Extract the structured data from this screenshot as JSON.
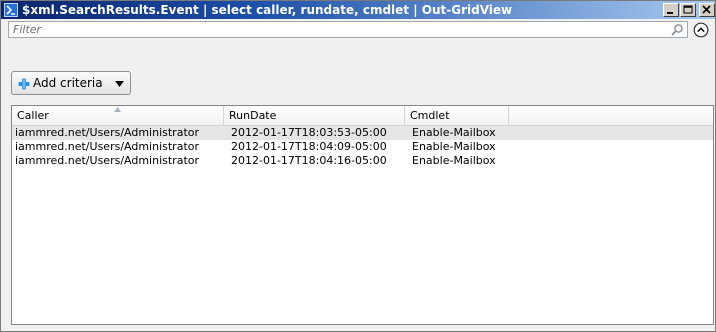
{
  "window": {
    "title": "$xml.SearchResults.Event | select caller, rundate, cmdlet | Out-GridView"
  },
  "filter": {
    "placeholder": "Filter",
    "value": ""
  },
  "toolbar": {
    "add_criteria_label": "Add criteria"
  },
  "grid": {
    "columns": [
      "Caller",
      "RunDate",
      "Cmdlet"
    ],
    "rows": [
      {
        "caller": "iammred.net/Users/Administrator",
        "rundate": "2012-01-17T18:03:53-05:00",
        "cmdlet": "Enable-Mailbox"
      },
      {
        "caller": "iammred.net/Users/Administrator",
        "rundate": "2012-01-17T18:04:09-05:00",
        "cmdlet": "Enable-Mailbox"
      },
      {
        "caller": "iammred.net/Users/Administrator",
        "rundate": "2012-01-17T18:04:16-05:00",
        "cmdlet": "Enable-Mailbox"
      }
    ],
    "selected_row": 0,
    "sort_column": "Caller"
  },
  "icons": {
    "app": "powershell-grid-icon",
    "search": "search-icon",
    "collapse": "collapse-up-icon",
    "add": "plus-icon",
    "dropdown": "chevron-down-icon"
  },
  "colors": {
    "title_gradient_start": "#0a246a",
    "title_gradient_end": "#a6caf0",
    "add_icon": "#2f8fdc",
    "selected_row": "#e5e5e5"
  }
}
